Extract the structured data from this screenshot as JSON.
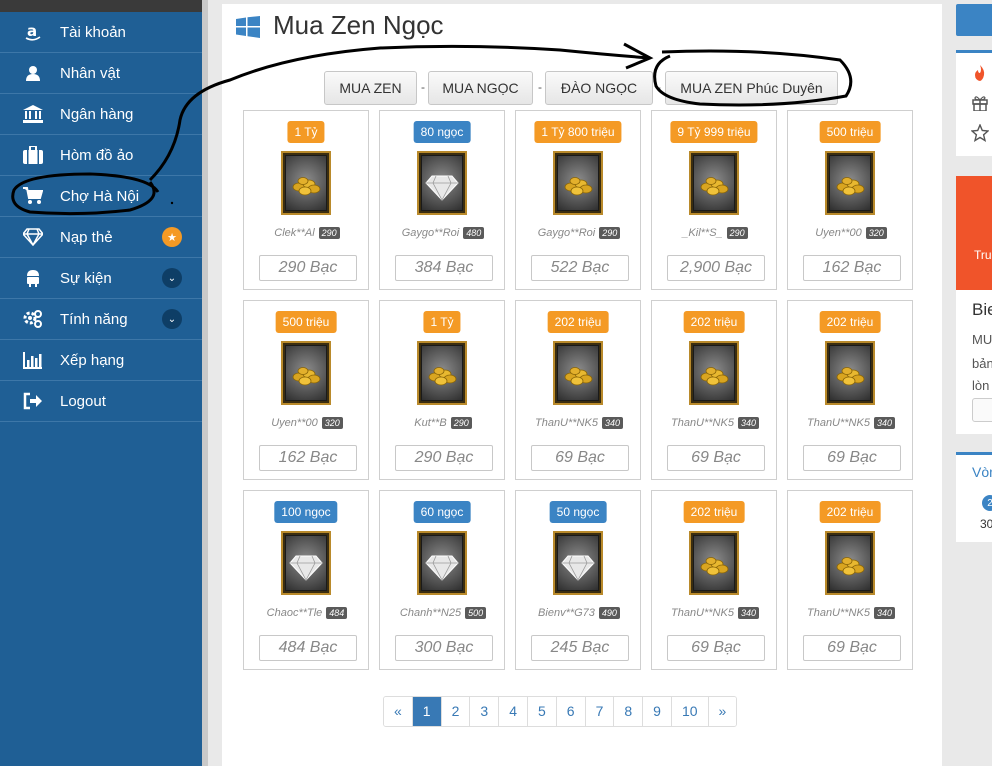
{
  "sidebar": {
    "items": [
      {
        "label": "Tài khoản",
        "icon": "amazon-icon"
      },
      {
        "label": "Nhân vật",
        "icon": "user-icon"
      },
      {
        "label": "Ngân hàng",
        "icon": "bank-icon"
      },
      {
        "label": "Hòm đồ ảo",
        "icon": "briefcase-icon"
      },
      {
        "label": "Chợ Hà Nội",
        "icon": "cart-icon"
      },
      {
        "label": "Nạp thẻ",
        "icon": "diamond-icon",
        "badge": "★"
      },
      {
        "label": "Sự kiện",
        "icon": "android-icon",
        "chevron": "⌄"
      },
      {
        "label": "Tính năng",
        "icon": "gears-icon",
        "chevron": "⌄"
      },
      {
        "label": "Xếp hạng",
        "icon": "bar-chart-icon"
      },
      {
        "label": "Logout",
        "icon": "sign-out-icon"
      }
    ]
  },
  "page": {
    "title": "Mua Zen Ngọc",
    "title_icon": "windows-icon"
  },
  "tabs": [
    {
      "label": "MUA ZEN"
    },
    {
      "label": "MUA NGỌC"
    },
    {
      "label": "ĐÀO NGỌC"
    },
    {
      "label": "MUA ZEN Phúc Duyên"
    }
  ],
  "tab_separator": "-",
  "items": [
    {
      "badge": "1 Tỷ",
      "badge_color": "orange",
      "kind": "zen",
      "seller": "Clek**Al",
      "level": "290",
      "price": "290 Bạc"
    },
    {
      "badge": "80 ngọc",
      "badge_color": "blue",
      "kind": "jewel",
      "seller": "Gaygo**Roi",
      "level": "480",
      "price": "384 Bạc"
    },
    {
      "badge": "1 Tỷ 800 triệu",
      "badge_color": "orange",
      "kind": "zen",
      "seller": "Gaygo**Roi",
      "level": "290",
      "price": "522 Bạc"
    },
    {
      "badge": "9 Tỷ 999 triệu",
      "badge_color": "orange",
      "kind": "zen",
      "seller": "_Kil**S_",
      "level": "290",
      "price": "2,900 Bạc"
    },
    {
      "badge": "500 triệu",
      "badge_color": "orange",
      "kind": "zen",
      "seller": "Uyen**00",
      "level": "320",
      "price": "162 Bạc"
    },
    {
      "badge": "500 triệu",
      "badge_color": "orange",
      "kind": "zen",
      "seller": "Uyen**00",
      "level": "320",
      "price": "162 Bạc"
    },
    {
      "badge": "1 Tỷ",
      "badge_color": "orange",
      "kind": "zen",
      "seller": "Kut**B",
      "level": "290",
      "price": "290 Bạc"
    },
    {
      "badge": "202 triệu",
      "badge_color": "orange",
      "kind": "zen",
      "seller": "ThanU**NK5",
      "level": "340",
      "price": "69 Bạc"
    },
    {
      "badge": "202 triệu",
      "badge_color": "orange",
      "kind": "zen",
      "seller": "ThanU**NK5",
      "level": "340",
      "price": "69 Bạc"
    },
    {
      "badge": "202 triệu",
      "badge_color": "orange",
      "kind": "zen",
      "seller": "ThanU**NK5",
      "level": "340",
      "price": "69 Bạc"
    },
    {
      "badge": "100 ngọc",
      "badge_color": "blue",
      "kind": "jewel",
      "seller": "Chaoc**Tle",
      "level": "484",
      "price": "484 Bạc"
    },
    {
      "badge": "60 ngọc",
      "badge_color": "blue",
      "kind": "jewel",
      "seller": "Chanh**N25",
      "level": "500",
      "price": "300 Bạc"
    },
    {
      "badge": "50 ngọc",
      "badge_color": "blue",
      "kind": "jewel",
      "seller": "Bienv**G73",
      "level": "490",
      "price": "245 Bạc"
    },
    {
      "badge": "202 triệu",
      "badge_color": "orange",
      "kind": "zen",
      "seller": "ThanU**NK5",
      "level": "340",
      "price": "69 Bạc"
    },
    {
      "badge": "202 triệu",
      "badge_color": "orange",
      "kind": "zen",
      "seller": "ThanU**NK5",
      "level": "340",
      "price": "69 Bạc"
    }
  ],
  "pagination": {
    "prev": "«",
    "next": "»",
    "pages": [
      "1",
      "2",
      "3",
      "4",
      "5",
      "6",
      "7",
      "8",
      "9",
      "10"
    ],
    "current": "1"
  },
  "right_column": {
    "panel_title": "Bie",
    "panel_lines": [
      "MU",
      "bản",
      "lòn"
    ],
    "orange_text": "Tru",
    "online_title": "Vòn",
    "online_badge": "2",
    "online_small": "30"
  },
  "colors": {
    "sidebar": "#1f5f95",
    "orange": "#f49a25",
    "blue": "#3b84c4",
    "annotation": "#000000"
  }
}
